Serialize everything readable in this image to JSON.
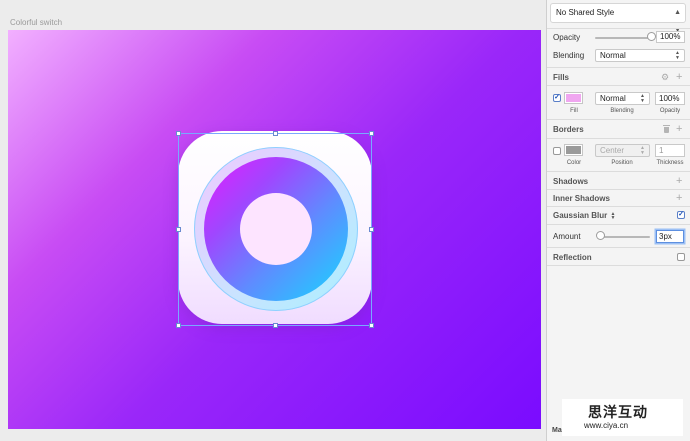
{
  "canvas": {
    "artboard_label": "Colorful switch"
  },
  "inspector": {
    "shared_style": "No Shared Style",
    "opacity_label": "Opacity",
    "opacity_value": "100%",
    "opacity_level": 1.0,
    "blending_label": "Blending",
    "blending_value": "Normal",
    "fills": {
      "title": "Fills",
      "enabled": true,
      "blend_value": "Normal",
      "opacity_value": "100%",
      "sub_labels": {
        "fill": "Fill",
        "blending": "Blending",
        "opacity": "Opacity"
      },
      "swatch_color": "#f0a6f0"
    },
    "borders": {
      "title": "Borders",
      "enabled": false,
      "position_value": "Center",
      "thickness_value": "1",
      "sub_labels": {
        "color": "Color",
        "position": "Position",
        "thickness": "Thickness"
      },
      "swatch_color": "#9a9a9a"
    },
    "shadows_title": "Shadows",
    "inner_shadows_title": "Inner Shadows",
    "gaussian_blur": {
      "title": "Gaussian Blur",
      "enabled": true,
      "amount_label": "Amount",
      "amount_value": "3px",
      "amount_level": 0.05
    },
    "reflection": {
      "title": "Reflection",
      "enabled": false
    }
  },
  "bottom_partial_label": "Ma",
  "watermark": {
    "text_cn": "思洋互动",
    "url": "www.ciya.cn"
  },
  "colors": {
    "gradient_start": "#f2b0ff",
    "gradient_end": "#7a0bff",
    "ring_start": "#e51cff",
    "ring_end": "#14d8ff",
    "selection": "#7aa8ff"
  }
}
